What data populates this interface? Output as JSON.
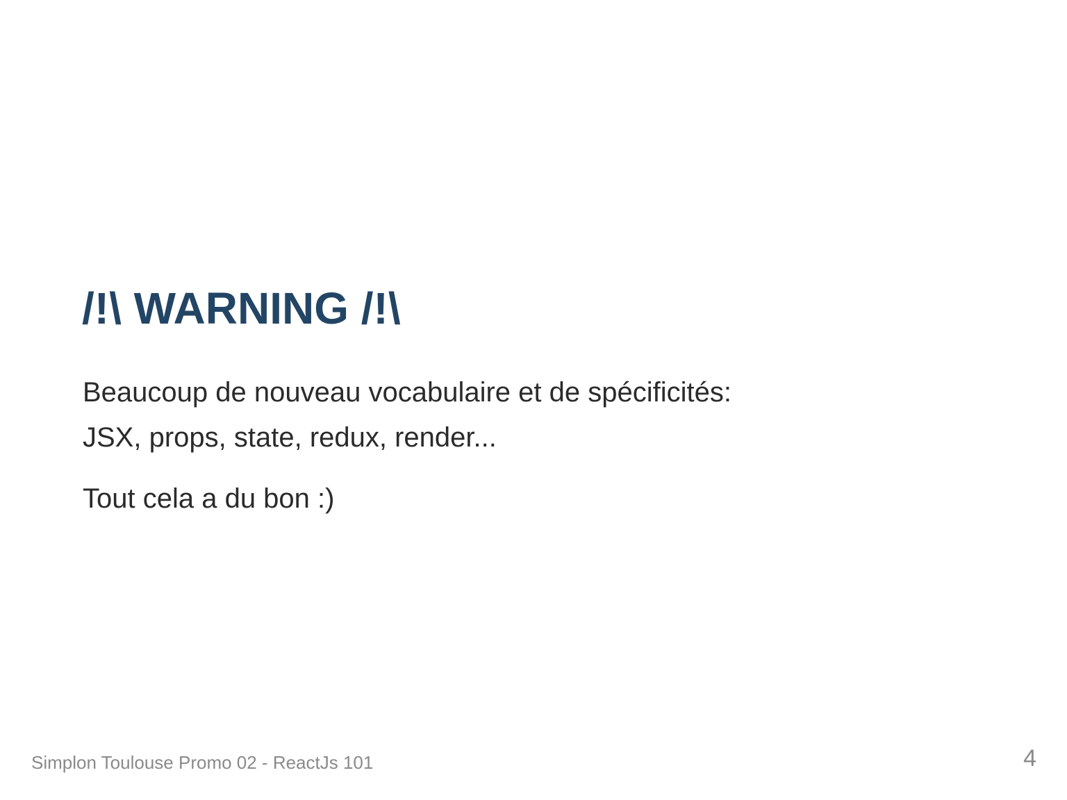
{
  "slide": {
    "title": "/!\\ WARNING /!\\",
    "body": [
      "Beaucoup de nouveau vocabulaire et de spécificités:",
      "JSX, props, state, redux, render...",
      "Tout cela a du bon :)"
    ]
  },
  "footer": {
    "text": "Simplon Toulouse Promo 02 - ReactJs 101",
    "page_number": "4"
  },
  "colors": {
    "title": "#234565",
    "body_text": "#2b2b2b",
    "footer_text": "#8a8a8a",
    "background": "#ffffff"
  }
}
